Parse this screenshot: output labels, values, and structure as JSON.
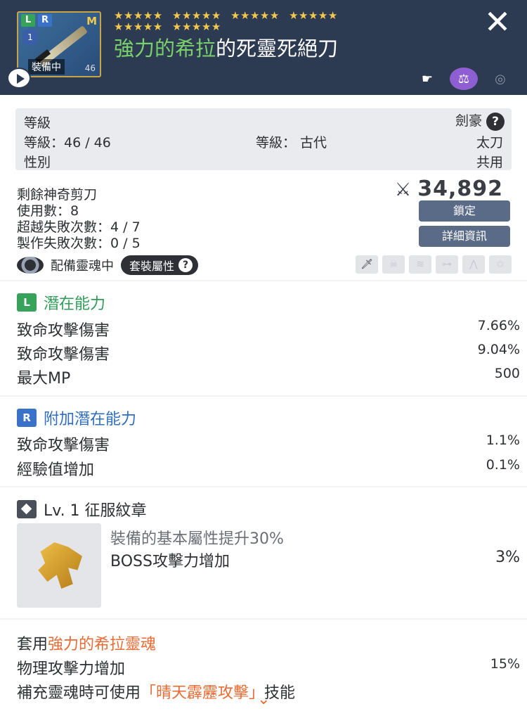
{
  "header": {
    "badge_l": "L",
    "badge_r": "R",
    "badge_m": "M",
    "badge_lv": "1",
    "equip_tag": "裝備中",
    "equip_lv": "46",
    "stars_row1": [
      "★★★★★",
      "★★★★★",
      "★★★★★",
      "★★★★★"
    ],
    "stars_row2": [
      "★★★★★",
      "★★★★★"
    ],
    "title_highlight": "強力的希拉",
    "title_rest": "的死靈死絕刀",
    "close_label": "✕",
    "icons": [
      "hand-icon",
      "scale-icon",
      "bag-icon"
    ]
  },
  "basic": {
    "grade_label": "等級",
    "job_label": "劍豪",
    "help_label": "?",
    "level_text": "等級：46 / 46",
    "tier_text": "等級： 古代",
    "weapon_type": "太刀",
    "gender_label": "性別",
    "gender_value": "共用",
    "scissors_text": "剩餘神奇剪刀",
    "use_count": "使用數：8",
    "transcend_fail": "超越失敗次數：4 / 7",
    "craft_fail": "製作失敗次數：0 / 5",
    "power_value": "34,892",
    "lock_button": "鎖定",
    "detail_button": "詳細資訊",
    "soul_equipped": "配備靈魂中",
    "set_attr_label": "套裝屬性",
    "set_help": "?"
  },
  "potential": {
    "badge": "L",
    "title": "潛在能力",
    "lines": [
      {
        "label": "致命攻擊傷害",
        "value": "7.66%"
      },
      {
        "label": "致命攻擊傷害",
        "value": "9.04%"
      },
      {
        "label": "最大MP",
        "value": "500"
      }
    ]
  },
  "additional": {
    "badge": "R",
    "title": "附加潛在能力",
    "lines": [
      {
        "label": "致命攻擊傷害",
        "value": "1.1%"
      },
      {
        "label": "經驗值增加",
        "value": "0.1%"
      }
    ]
  },
  "emblem": {
    "title": "Lv. 1 征服紋章",
    "desc": "裝備的基本屬性提升30%",
    "stat_label": "BOSS攻擊力增加",
    "stat_value": "3%"
  },
  "soul": {
    "prefix": "套用",
    "soul_name": "強力的希拉靈魂",
    "stat_label": "物理攻擊力增加",
    "stat_value": "15%",
    "skill_prefix": "補充靈魂時可使用",
    "skill_name": "「晴天霹靂攻擊」",
    "skill_suffix": "技能"
  },
  "colors": {
    "header_bg": "#2c3a52",
    "green": "#2f9c59",
    "blue": "#2f6ec2",
    "orange": "#ea6c34"
  }
}
